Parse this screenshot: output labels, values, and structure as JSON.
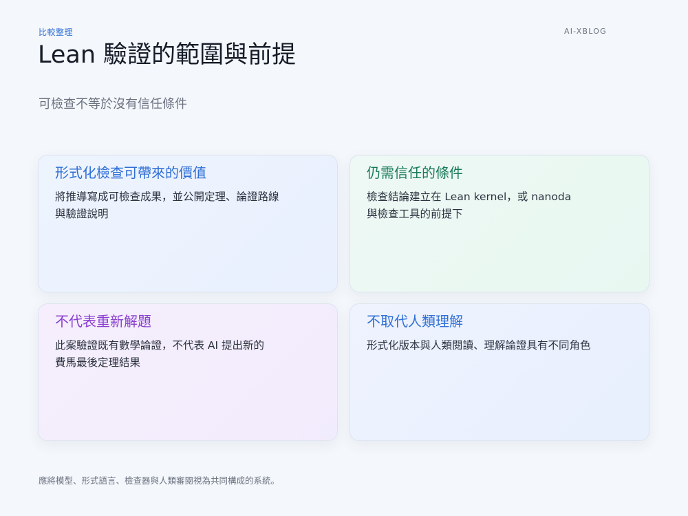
{
  "header": {
    "eyebrow": "比較整理",
    "brand": "AI-XBLOG",
    "title": "Lean 驗證的範圍與前提",
    "subtitle": "可檢查不等於沒有信任條件"
  },
  "cards": [
    {
      "heading": "形式化檢查可帶來的價值",
      "lines": [
        "將推導寫成可檢查成果，並公開定理、論證路線",
        "與驗證說明"
      ],
      "accent": "#2f6fd6"
    },
    {
      "heading": "仍需信任的條件",
      "lines": [
        "檢查結論建立在 Lean kernel，或 nanoda",
        "與檢查工具的前提下"
      ],
      "accent": "#177a57"
    },
    {
      "heading": "不代表重新解題",
      "lines": [
        "此案驗證既有數學論證，不代表 AI 提出新的",
        "費馬最後定理結果"
      ],
      "accent": "#8a3fcf"
    },
    {
      "heading": "不取代人類理解",
      "lines": [
        "形式化版本與人類閱讀、理解論證具有不同角色"
      ],
      "accent": "#2f6fd6"
    }
  ],
  "footer": {
    "note": "應將模型、形式語言、檢查器與人類審閱視為共同構成的系統。"
  }
}
